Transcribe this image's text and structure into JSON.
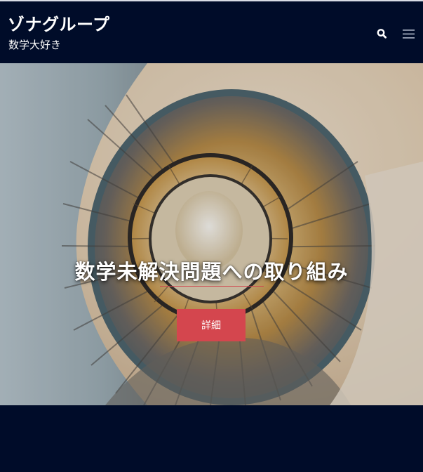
{
  "header": {
    "site_title": "ゾナグループ",
    "tagline": "数学大好き",
    "search_icon": "search-icon",
    "menu_icon": "hamburger-menu-icon"
  },
  "hero": {
    "image": "spiral-staircase-photo",
    "title": "数学未解決問題への取り組み",
    "button_label": "詳細"
  },
  "colors": {
    "header_bg": "#000c29",
    "accent": "#d4464e",
    "text": "#ffffff"
  }
}
